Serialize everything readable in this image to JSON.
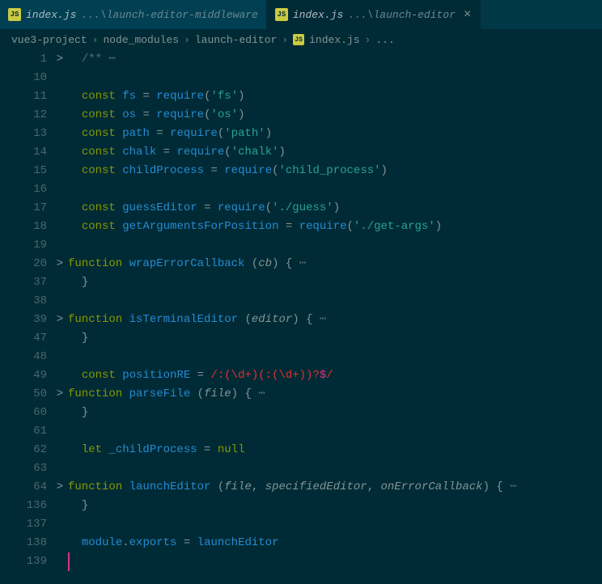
{
  "tabs": [
    {
      "icon": "JS",
      "name": "index.js",
      "subpath": "...\\launch-editor-middleware",
      "active": false
    },
    {
      "icon": "JS",
      "name": "index.js",
      "subpath": "...\\launch-editor",
      "active": true
    }
  ],
  "breadcrumbs": {
    "parts": [
      "vue3-project",
      "node_modules",
      "launch-editor",
      "index.js",
      "..."
    ],
    "icon": "JS",
    "sep": "›"
  },
  "lines": [
    {
      "num": "1",
      "fold": ">",
      "tokens": [
        [
          "comment",
          "/**"
        ],
        [
          "fold-dots",
          " ⋯"
        ]
      ]
    },
    {
      "num": "10",
      "fold": "",
      "tokens": []
    },
    {
      "num": "11",
      "fold": "",
      "tokens": [
        [
          "kw",
          "const "
        ],
        [
          "var",
          "fs"
        ],
        [
          "punct",
          " = "
        ],
        [
          "func",
          "require"
        ],
        [
          "punct",
          "("
        ],
        [
          "str",
          "'fs'"
        ],
        [
          "punct",
          ")"
        ]
      ]
    },
    {
      "num": "12",
      "fold": "",
      "tokens": [
        [
          "kw",
          "const "
        ],
        [
          "var",
          "os"
        ],
        [
          "punct",
          " = "
        ],
        [
          "func",
          "require"
        ],
        [
          "punct",
          "("
        ],
        [
          "str",
          "'os'"
        ],
        [
          "punct",
          ")"
        ]
      ]
    },
    {
      "num": "13",
      "fold": "",
      "tokens": [
        [
          "kw",
          "const "
        ],
        [
          "var",
          "path"
        ],
        [
          "punct",
          " = "
        ],
        [
          "func",
          "require"
        ],
        [
          "punct",
          "("
        ],
        [
          "str",
          "'path'"
        ],
        [
          "punct",
          ")"
        ]
      ]
    },
    {
      "num": "14",
      "fold": "",
      "tokens": [
        [
          "kw",
          "const "
        ],
        [
          "var",
          "chalk"
        ],
        [
          "punct",
          " = "
        ],
        [
          "func",
          "require"
        ],
        [
          "punct",
          "("
        ],
        [
          "str",
          "'chalk'"
        ],
        [
          "punct",
          ")"
        ]
      ]
    },
    {
      "num": "15",
      "fold": "",
      "tokens": [
        [
          "kw",
          "const "
        ],
        [
          "var",
          "childProcess"
        ],
        [
          "punct",
          " = "
        ],
        [
          "func",
          "require"
        ],
        [
          "punct",
          "("
        ],
        [
          "str",
          "'child_process'"
        ],
        [
          "punct",
          ")"
        ]
      ]
    },
    {
      "num": "16",
      "fold": "",
      "tokens": []
    },
    {
      "num": "17",
      "fold": "",
      "tokens": [
        [
          "kw",
          "const "
        ],
        [
          "var",
          "guessEditor"
        ],
        [
          "punct",
          " = "
        ],
        [
          "func",
          "require"
        ],
        [
          "punct",
          "("
        ],
        [
          "str",
          "'./guess'"
        ],
        [
          "punct",
          ")"
        ]
      ]
    },
    {
      "num": "18",
      "fold": "",
      "tokens": [
        [
          "kw",
          "const "
        ],
        [
          "var",
          "getArgumentsForPosition"
        ],
        [
          "punct",
          " = "
        ],
        [
          "func",
          "require"
        ],
        [
          "punct",
          "("
        ],
        [
          "str",
          "'./get-args'"
        ],
        [
          "punct",
          ")"
        ]
      ]
    },
    {
      "num": "19",
      "fold": "",
      "tokens": []
    },
    {
      "num": "20",
      "fold": ">",
      "outdent": true,
      "tokens": [
        [
          "kw",
          "function "
        ],
        [
          "func",
          "wrapErrorCallback"
        ],
        [
          "punct",
          " ("
        ],
        [
          "param",
          "cb"
        ],
        [
          "punct",
          ") {"
        ],
        [
          "fold-dots",
          " ⋯"
        ]
      ]
    },
    {
      "num": "37",
      "fold": "",
      "tokens": [
        [
          "punct",
          "}"
        ]
      ]
    },
    {
      "num": "38",
      "fold": "",
      "tokens": []
    },
    {
      "num": "39",
      "fold": ">",
      "outdent": true,
      "tokens": [
        [
          "kw",
          "function "
        ],
        [
          "func",
          "isTerminalEditor"
        ],
        [
          "punct",
          " ("
        ],
        [
          "param",
          "editor"
        ],
        [
          "punct",
          ") {"
        ],
        [
          "fold-dots",
          " ⋯"
        ]
      ]
    },
    {
      "num": "47",
      "fold": "",
      "tokens": [
        [
          "punct",
          "}"
        ]
      ]
    },
    {
      "num": "48",
      "fold": "",
      "tokens": []
    },
    {
      "num": "49",
      "fold": "",
      "tokens": [
        [
          "kw",
          "const "
        ],
        [
          "var",
          "positionRE"
        ],
        [
          "punct",
          " = "
        ],
        [
          "regex",
          "/:(\\d+)(:(\\d+))?"
        ],
        [
          "op",
          "$"
        ],
        [
          "regex",
          "/"
        ]
      ]
    },
    {
      "num": "50",
      "fold": ">",
      "outdent": true,
      "tokens": [
        [
          "kw",
          "function "
        ],
        [
          "func",
          "parseFile"
        ],
        [
          "punct",
          " ("
        ],
        [
          "param",
          "file"
        ],
        [
          "punct",
          ") {"
        ],
        [
          "fold-dots",
          " ⋯"
        ]
      ]
    },
    {
      "num": "60",
      "fold": "",
      "tokens": [
        [
          "punct",
          "}"
        ]
      ]
    },
    {
      "num": "61",
      "fold": "",
      "tokens": []
    },
    {
      "num": "62",
      "fold": "",
      "tokens": [
        [
          "kw",
          "let "
        ],
        [
          "var",
          "_childProcess"
        ],
        [
          "punct",
          " = "
        ],
        [
          "kw",
          "null"
        ]
      ]
    },
    {
      "num": "63",
      "fold": "",
      "tokens": []
    },
    {
      "num": "64",
      "fold": ">",
      "outdent": true,
      "tokens": [
        [
          "kw",
          "function "
        ],
        [
          "func",
          "launchEditor"
        ],
        [
          "punct",
          " ("
        ],
        [
          "param",
          "file"
        ],
        [
          "punct",
          ", "
        ],
        [
          "param",
          "specifiedEditor"
        ],
        [
          "punct",
          ", "
        ],
        [
          "param",
          "onErrorCallback"
        ],
        [
          "punct",
          ") {"
        ],
        [
          "fold-dots",
          " ⋯"
        ]
      ]
    },
    {
      "num": "136",
      "fold": "",
      "tokens": [
        [
          "punct",
          "}"
        ]
      ]
    },
    {
      "num": "137",
      "fold": "",
      "tokens": []
    },
    {
      "num": "138",
      "fold": "",
      "tokens": [
        [
          "var",
          "module"
        ],
        [
          "punct",
          "."
        ],
        [
          "var",
          "exports"
        ],
        [
          "punct",
          " = "
        ],
        [
          "var",
          "launchEditor"
        ]
      ]
    },
    {
      "num": "139",
      "fold": "",
      "cursor": true,
      "tokens": []
    }
  ]
}
